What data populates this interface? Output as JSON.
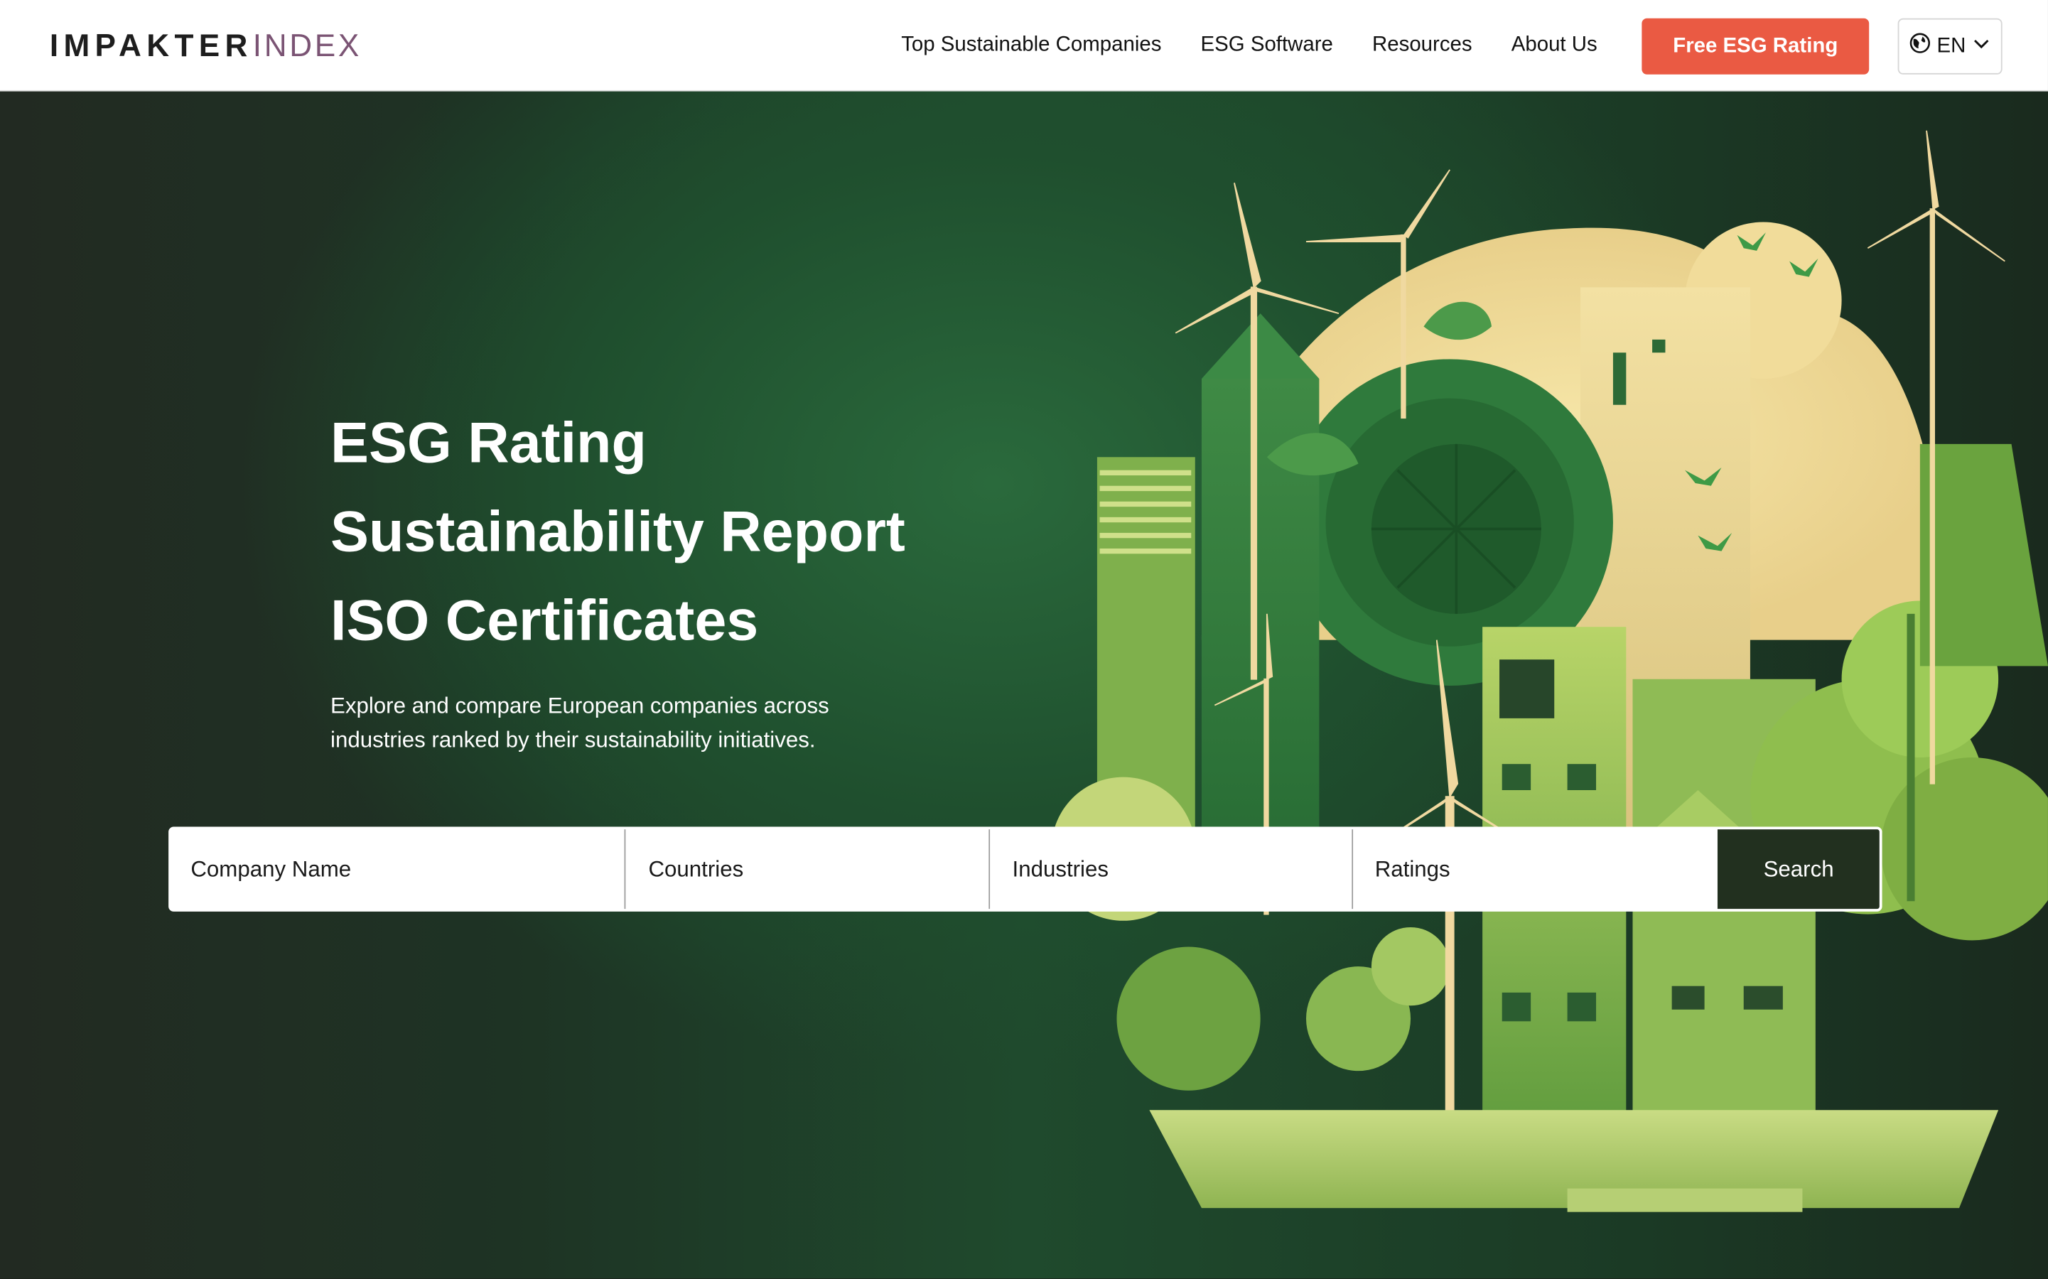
{
  "brand": {
    "logo_primary": "IMPAKTER",
    "logo_secondary": "INDEX"
  },
  "nav": {
    "items": [
      {
        "label": "Top Sustainable Companies"
      },
      {
        "label": "ESG Software"
      },
      {
        "label": "Resources"
      },
      {
        "label": "About Us"
      }
    ],
    "cta_label": "Free ESG Rating",
    "language": "EN"
  },
  "hero": {
    "title_lines": [
      "ESG Rating",
      "Sustainability Report",
      "ISO Certificates"
    ],
    "description": "Explore and compare European companies across industries ranked by their sustainability initiatives."
  },
  "search": {
    "company_placeholder": "Company Name",
    "countries_placeholder": "Countries",
    "industries_placeholder": "Industries",
    "ratings_placeholder": "Ratings",
    "button_label": "Search"
  },
  "colors": {
    "accent": "#ea5a43",
    "logo_secondary": "#7b5474",
    "search_button": "#22301f",
    "hero_green": "#1f4a2d"
  },
  "icons": {
    "language": "globe-icon",
    "dropdown": "chevron-down-icon"
  }
}
